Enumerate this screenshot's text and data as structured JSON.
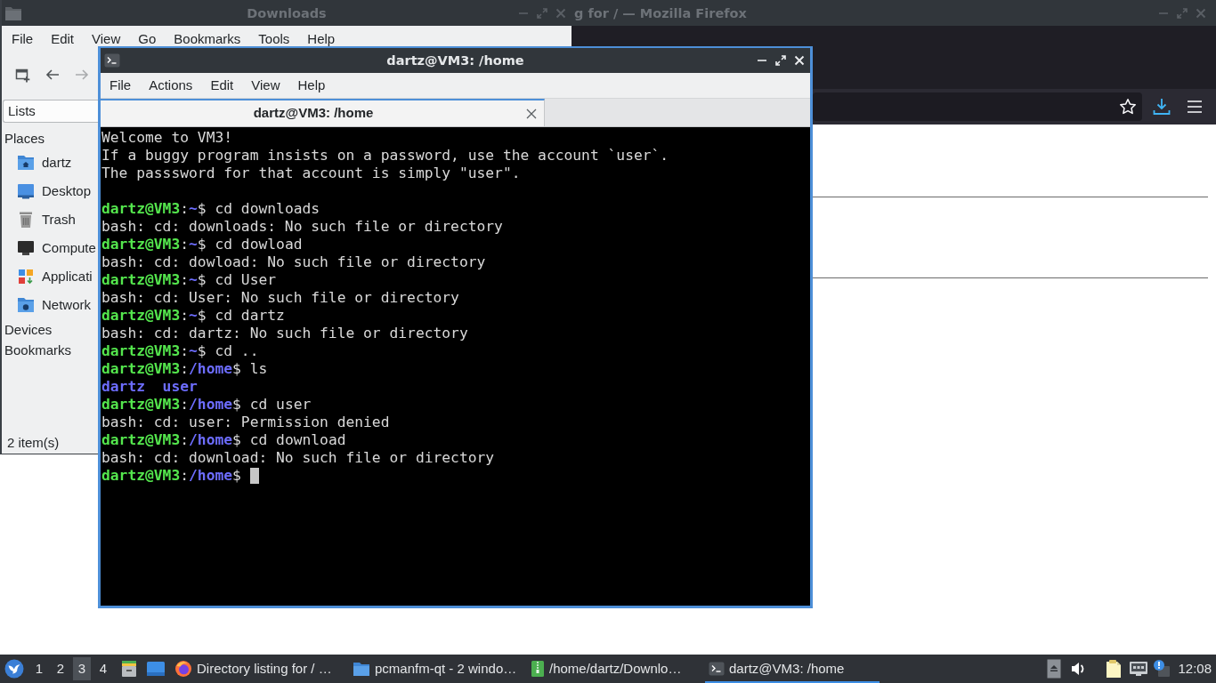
{
  "firefox_window": {
    "title": "g for / — Mozilla Firefox",
    "active": false
  },
  "file_manager": {
    "title": "Downloads",
    "active": false,
    "menu": [
      "File",
      "Edit",
      "View",
      "Go",
      "Bookmarks",
      "Tools",
      "Help"
    ],
    "toolbar_buttons": [
      {
        "disabled": false
      },
      {
        "disabled": false
      },
      {
        "disabled": true
      }
    ],
    "side_pane_mode": "Lists",
    "sidebar": [
      {
        "title": "Places",
        "items": [
          "dartz",
          "Desktop",
          "Trash",
          "Compute",
          "Applicati",
          "Network"
        ]
      },
      {
        "title": "Devices"
      },
      {
        "title": "Bookmarks"
      }
    ],
    "status_bar": "2 item(s)"
  },
  "terminal": {
    "title": "dartz@VM3: /home",
    "active": true,
    "menu": [
      "File",
      "Actions",
      "Edit",
      "View",
      "Help"
    ],
    "tabs": [
      {
        "label": "dartz@VM3: /home",
        "selected": true
      }
    ],
    "lines": [
      {
        "kind": "message",
        "text": "Welcome to VM3!"
      },
      {
        "kind": "message",
        "text": "If a buggy program insists on a password, use the account `user`."
      },
      {
        "kind": "message",
        "text": "The passsword for that account is simply \"user\"."
      },
      {
        "kind": "blank"
      },
      {
        "kind": "prompt",
        "user_host": "dartz@VM3",
        "separator": ":",
        "path": "~",
        "command": "$ cd downloads",
        "cursor": false
      },
      {
        "kind": "output",
        "text": "bash: cd: downloads: No such file or directory"
      },
      {
        "kind": "prompt",
        "user_host": "dartz@VM3",
        "separator": ":",
        "path": "~",
        "command": "$ cd dowload",
        "cursor": false
      },
      {
        "kind": "output",
        "text": "bash: cd: dowload: No such file or directory"
      },
      {
        "kind": "prompt",
        "user_host": "dartz@VM3",
        "separator": ":",
        "path": "~",
        "command": "$ cd User",
        "cursor": false
      },
      {
        "kind": "output",
        "text": "bash: cd: User: No such file or directory"
      },
      {
        "kind": "prompt",
        "user_host": "dartz@VM3",
        "separator": ":",
        "path": "~",
        "command": "$ cd dartz",
        "cursor": false
      },
      {
        "kind": "output",
        "text": "bash: cd: dartz: No such file or directory"
      },
      {
        "kind": "prompt",
        "user_host": "dartz@VM3",
        "separator": ":",
        "path": "~",
        "command": "$ cd ..",
        "cursor": false
      },
      {
        "kind": "prompt",
        "user_host": "dartz@VM3",
        "separator": ":",
        "path": "/home",
        "command": "$ ls",
        "cursor": false
      },
      {
        "kind": "listing",
        "text": "dartz  user"
      },
      {
        "kind": "prompt",
        "user_host": "dartz@VM3",
        "separator": ":",
        "path": "/home",
        "command": "$ cd user",
        "cursor": false
      },
      {
        "kind": "output",
        "text": "bash: cd: user: Permission denied"
      },
      {
        "kind": "prompt",
        "user_host": "dartz@VM3",
        "separator": ":",
        "path": "/home",
        "command": "$ cd download",
        "cursor": false
      },
      {
        "kind": "output",
        "text": "bash: cd: download: No such file or directory"
      },
      {
        "kind": "prompt",
        "user_host": "dartz@VM3",
        "separator": ":",
        "path": "/home",
        "command": "$",
        "cursor": true
      }
    ]
  },
  "taskbar": {
    "workspaces": [
      {
        "label": "1",
        "selected": false
      },
      {
        "label": "2",
        "selected": false
      },
      {
        "label": "3",
        "selected": true
      },
      {
        "label": "4",
        "selected": false
      }
    ],
    "tasks": [
      {
        "label": "Directory listing for / …",
        "selected": false
      },
      {
        "label": "pcmanfm-qt - 2 windo…",
        "selected": false
      },
      {
        "label": "/home/dartz/Downlo…",
        "selected": false
      },
      {
        "label": "dartz@VM3: /home",
        "selected": true
      }
    ],
    "clock": "12:08"
  }
}
